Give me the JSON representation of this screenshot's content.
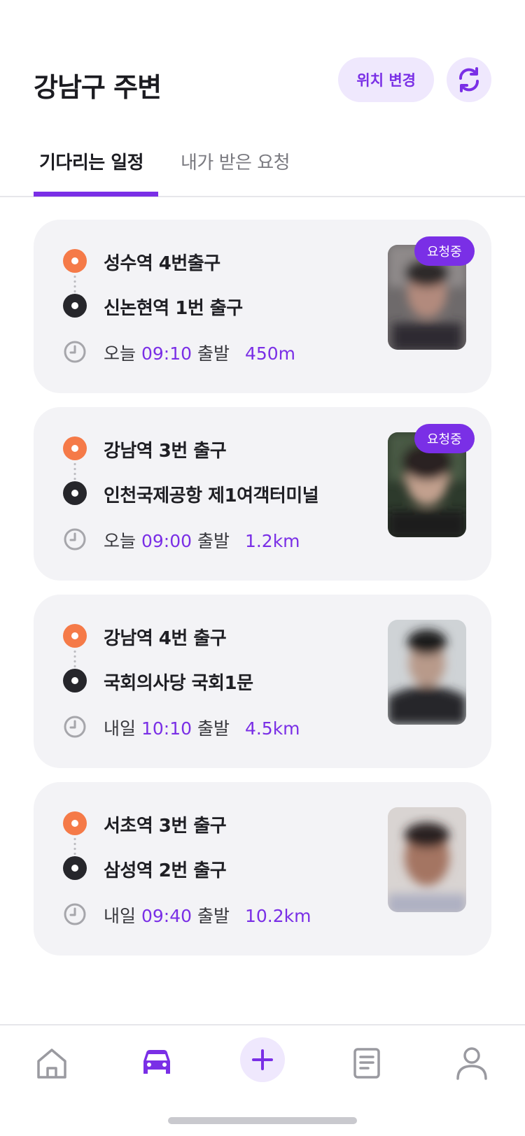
{
  "header": {
    "title": "강남구 주변",
    "change_location_label": "위치 변경",
    "refresh_icon": "refresh-icon"
  },
  "tabs": [
    {
      "label": "기다리는 일정",
      "active": true
    },
    {
      "label": "내가 받은 요청",
      "active": false
    }
  ],
  "colors": {
    "accent": "#7a2fe6",
    "accent_soft": "#efe8fd",
    "origin_dot": "#f57a48",
    "destination_dot": "#26262b",
    "card_bg": "#f3f3f6"
  },
  "rides": [
    {
      "origin": "성수역 4번출구",
      "destination": "신논현역 1번 출구",
      "day": "오늘",
      "time": "09:10",
      "departure_label": "출발",
      "distance": "450m",
      "badge": "요청중"
    },
    {
      "origin": "강남역 3번 출구",
      "destination": "인천국제공항 제1여객터미널",
      "day": "오늘",
      "time": "09:00",
      "departure_label": "출발",
      "distance": "1.2km",
      "badge": "요청중"
    },
    {
      "origin": "강남역 4번 출구",
      "destination": "국회의사당 국회1문",
      "day": "내일",
      "time": "10:10",
      "departure_label": "출발",
      "distance": "4.5km",
      "badge": null
    },
    {
      "origin": "서초역 3번 출구",
      "destination": "삼성역 2번 출구",
      "day": "내일",
      "time": "09:40",
      "departure_label": "출발",
      "distance": "10.2km",
      "badge": null
    }
  ],
  "bottom_nav": [
    {
      "icon": "home-icon",
      "active": false
    },
    {
      "icon": "car-icon",
      "active": true
    },
    {
      "icon": "plus-icon",
      "active": false
    },
    {
      "icon": "document-icon",
      "active": false
    },
    {
      "icon": "profile-icon",
      "active": false
    }
  ]
}
